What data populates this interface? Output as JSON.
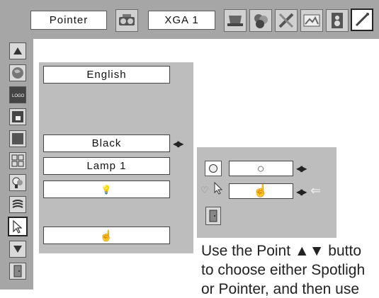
{
  "topbar": {
    "mode_label": "Pointer",
    "resolution_label": "XGA 1",
    "icons": [
      "projector-icon",
      "display-icon",
      "color-icon",
      "tools-icon",
      "image-icon",
      "speaker-icon",
      "pointer-setting-icon"
    ]
  },
  "sidebar": {
    "icons": [
      "up-arrow-icon",
      "globe-icon",
      "logo-icon",
      "screen-icon",
      "background-icon",
      "display-layout-icon",
      "lamp-icon",
      "remote-icon",
      "pointer-icon",
      "down-arrow-icon",
      "exit-icon"
    ]
  },
  "menu": {
    "language_value": "English",
    "background_value": "Black",
    "lamp_value": "Lamp 1",
    "bulb_symbol": "💡",
    "pointer_symbol": "☝"
  },
  "submenu": {
    "spotlight_symbol": "○",
    "pointer_symbol": "☝",
    "selector_symbol": "↖",
    "heart_symbol": "♡",
    "return_symbol": "⇐"
  },
  "caption": {
    "line1": "Use the Point ▲▼ butto",
    "line2": "to choose either Spotligh",
    "line3": "or Pointer, and then use"
  }
}
